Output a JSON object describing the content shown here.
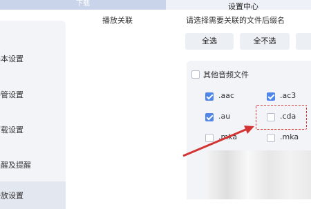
{
  "tabs": {
    "download": "下载"
  },
  "window": {
    "title": "设置中心"
  },
  "page": {
    "section_label": "播放关联",
    "instruction": "请选择需要关联的文件后缀名"
  },
  "buttons": {
    "select_all": "全选",
    "select_none": "全不选"
  },
  "sidebar": {
    "items": [
      {
        "label": "基本设置"
      },
      {
        "label": "接管设置"
      },
      {
        "label": "下载设置"
      },
      {
        "label": "提醒及提醒"
      },
      {
        "label": "播放设置"
      }
    ]
  },
  "other_audio": {
    "label": "其他音频文件",
    "checked": false
  },
  "extensions": [
    {
      "label": ".aac",
      "checked": true
    },
    {
      "label": ".ac3",
      "checked": true
    },
    {
      "label": ".au",
      "checked": true
    },
    {
      "label": ".cda",
      "checked": false
    },
    {
      "label": ".mka",
      "checked": false
    },
    {
      "label": ".mka",
      "checked": false
    }
  ],
  "colors": {
    "accent": "#4f86e8",
    "annotation": "#d33333"
  }
}
